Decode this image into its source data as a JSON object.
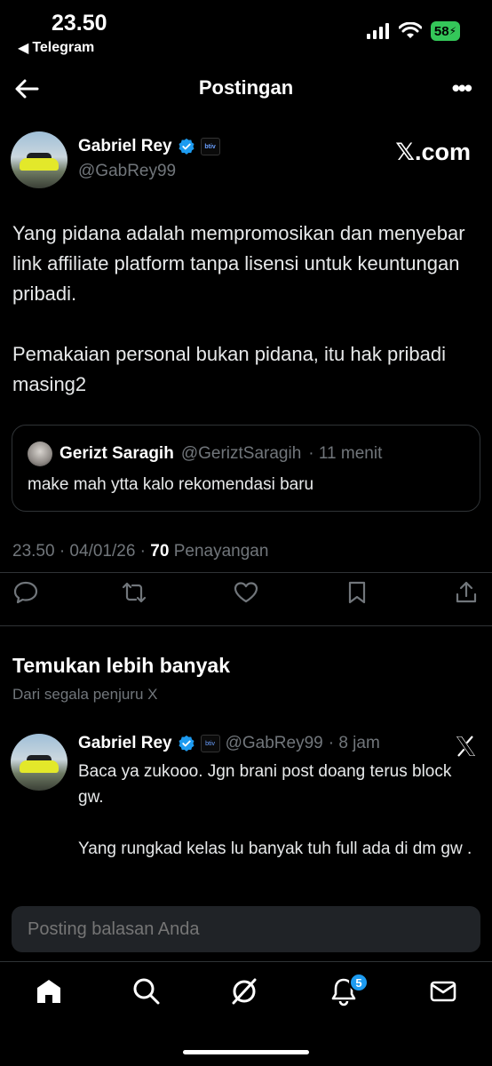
{
  "status_bar": {
    "time": "23.50",
    "back_app": "Telegram",
    "battery": "58"
  },
  "header": {
    "title": "Postingan"
  },
  "post": {
    "author_name": "Gabriel Rey",
    "author_handle": "@GabRey99",
    "affiliate_badge": "btiv",
    "source_label": "𝕏.com",
    "paragraphs": [
      "Yang pidana adalah mempromosikan dan menyebar link affiliate platform tanpa lisensi untuk keuntungan pribadi.",
      "Pemakaian personal bukan pidana, itu hak pribadi masing2"
    ],
    "quote": {
      "name": "Gerizt Saragih",
      "handle": "@GeriztSaragih",
      "time": "· 11 menit",
      "text": "make mah ytta kalo rekomendasi baru"
    },
    "meta_time": "23.50 · 04/01/26 · ",
    "views_count": "70",
    "views_label": " Penayangan"
  },
  "discover": {
    "title": "Temukan lebih banyak",
    "subtitle": "Dari segala penjuru X"
  },
  "feed_item": {
    "name": "Gabriel Rey",
    "handle": "@GabRey99",
    "time": "· 8 jam",
    "paragraphs": [
      "Baca ya zukooo. Jgn brani post doang terus block gw.",
      "Yang rungkad kelas lu banyak tuh full ada di dm gw ."
    ]
  },
  "reply": {
    "placeholder": "Posting balasan Anda"
  },
  "tabbar": {
    "notification_count": "5"
  },
  "colors": {
    "background": "#000000",
    "accent": "#1d9bf0",
    "secondary_text": "#71767b",
    "battery": "#34c759"
  }
}
